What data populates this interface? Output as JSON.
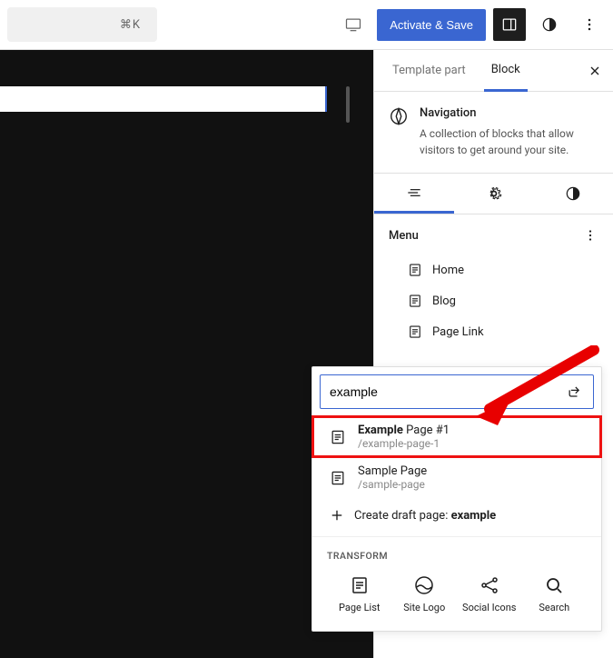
{
  "topbar": {
    "cmd_hint": "⌘K",
    "save_label": "Activate & Save"
  },
  "sidebar": {
    "tabs": [
      "Template part",
      "Block"
    ],
    "active_tab": 1,
    "block": {
      "title": "Navigation",
      "description": "A collection of blocks that allow visitors to get around your site."
    },
    "menu": {
      "title": "Menu",
      "items": [
        {
          "label": "Home"
        },
        {
          "label": "Blog"
        },
        {
          "label": "Page Link"
        }
      ]
    }
  },
  "dropdown": {
    "search_value": "example",
    "results": [
      {
        "title_bold": "Example",
        "title_rest": " Page #1",
        "slug": "/example-page-1",
        "highlighted": true
      },
      {
        "title_bold": "",
        "title_rest": "Sample Page",
        "slug": "/sample-page",
        "highlighted": false
      }
    ],
    "create_prefix": "Create draft page: ",
    "create_term": "example",
    "transform_label": "TRANSFORM",
    "transforms": [
      {
        "label": "Page List"
      },
      {
        "label": "Site Logo"
      },
      {
        "label": "Social Icons"
      },
      {
        "label": "Search"
      }
    ]
  }
}
